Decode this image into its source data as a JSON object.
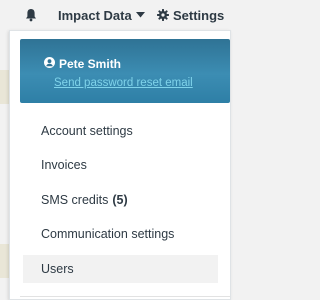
{
  "topbar": {
    "bell_icon": "bell-icon",
    "impact_label": "Impact Data",
    "settings_label": "Settings"
  },
  "user_menu": {
    "name": "Pete Smith",
    "reset_link": "Send password reset email",
    "items": [
      {
        "label": "Account settings"
      },
      {
        "label": "Invoices"
      },
      {
        "label": "SMS credits",
        "count": "(5)"
      },
      {
        "label": "Communication settings"
      },
      {
        "label": "Users",
        "active": true
      }
    ]
  },
  "colors": {
    "header_top": "#2f7395",
    "header_bottom": "#2e7fa6",
    "link": "#7fd3ea",
    "text": "#2e3a44",
    "active_row": "#f2f2f2"
  }
}
